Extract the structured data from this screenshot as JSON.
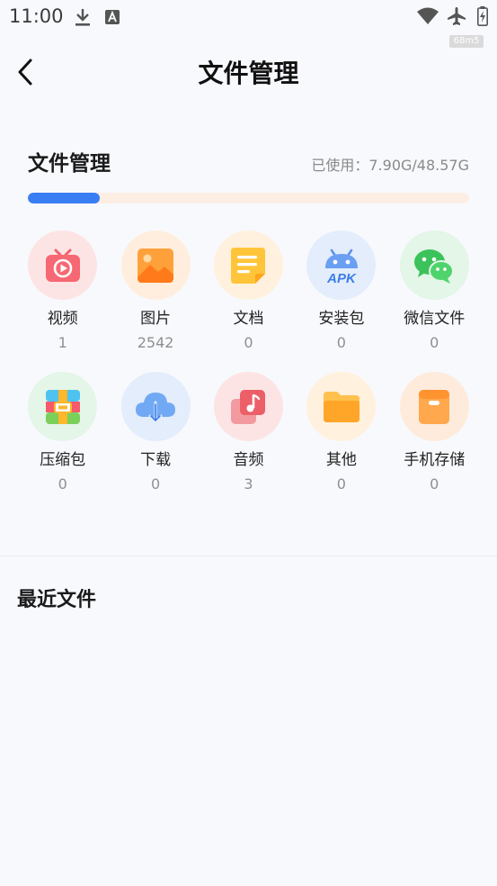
{
  "status_bar": {
    "time": "11:00",
    "speed": "68m5"
  },
  "header": {
    "title": "文件管理"
  },
  "storage": {
    "title": "文件管理",
    "usage": "已使用：7.90G/48.57G",
    "used_fraction": 0.1627
  },
  "categories": [
    {
      "label": "视频",
      "count": "1"
    },
    {
      "label": "图片",
      "count": "2542"
    },
    {
      "label": "文档",
      "count": "0"
    },
    {
      "label": "安装包",
      "count": "0",
      "icon_text": "APK"
    },
    {
      "label": "微信文件",
      "count": "0"
    },
    {
      "label": "压缩包",
      "count": "0"
    },
    {
      "label": "下载",
      "count": "0"
    },
    {
      "label": "音频",
      "count": "3"
    },
    {
      "label": "其他",
      "count": "0"
    },
    {
      "label": "手机存储",
      "count": "0"
    }
  ],
  "recent": {
    "title": "最近文件"
  },
  "colors": {
    "accent": "#3a7ef3",
    "track": "#fdeee4",
    "background": "#f8f9fd"
  }
}
